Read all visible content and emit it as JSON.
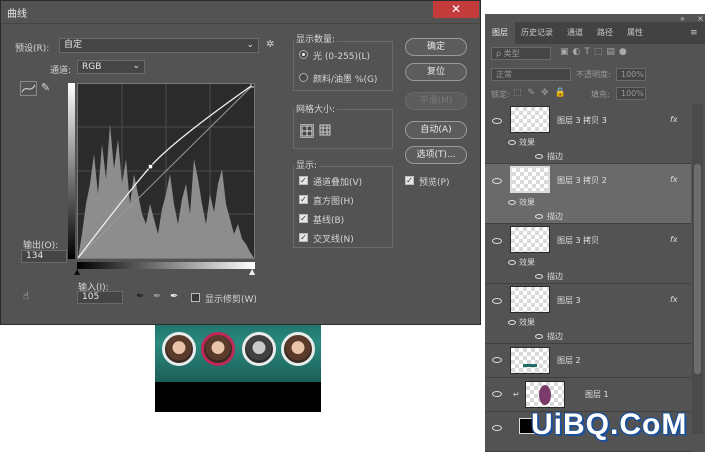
{
  "dialog": {
    "title": "曲线",
    "close": "✕",
    "preset_label": "预设(R):",
    "preset_value": "自定",
    "channel_label": "通道:",
    "channel_value": "RGB",
    "output_label": "输出(O):",
    "output_value": "134",
    "input_label": "输入(I):",
    "input_value": "105",
    "show_clipping": "显示修剪(W)",
    "buttons": {
      "ok": "确定",
      "reset": "复位",
      "smooth": "平滑(M)",
      "auto": "自动(A)",
      "options": "选项(T)..."
    },
    "preview": "预览(P)",
    "show_amount": {
      "title": "显示数量:",
      "light": "光 (0-255)(L)",
      "pigment": "颜料/油墨 %(G)",
      "selected": "light"
    },
    "grid_size": "网格大小:",
    "show": {
      "title": "显示:",
      "items": [
        "通道叠加(V)",
        "直方图(H)",
        "基线(B)",
        "交叉线(N)"
      ]
    },
    "curve_point": {
      "input": 105,
      "output": 134
    }
  },
  "layers_panel": {
    "tabs": [
      "图层",
      "历史记录",
      "通道",
      "路径",
      "属性"
    ],
    "kind_label": "ρ 类型",
    "blend_mode": "正常",
    "opacity_label": "不透明度:",
    "opacity_value": "100%",
    "lock_label": "锁定:",
    "fill_label": "填充:",
    "fill_value": "100%",
    "layers": [
      {
        "name": "图层 3 拷贝 3",
        "fx": "fx",
        "effects": "效果",
        "stroke": "描边"
      },
      {
        "name": "图层 3 拷贝 2",
        "fx": "fx",
        "effects": "效果",
        "stroke": "描边"
      },
      {
        "name": "图层 3 拷贝",
        "fx": "fx",
        "effects": "效果",
        "stroke": "描边"
      },
      {
        "name": "图层 3",
        "fx": "fx",
        "effects": "效果",
        "stroke": "描边"
      },
      {
        "name": "图层 2"
      },
      {
        "name": "图层 1"
      }
    ]
  },
  "watermark": "UiBQ.CoM"
}
